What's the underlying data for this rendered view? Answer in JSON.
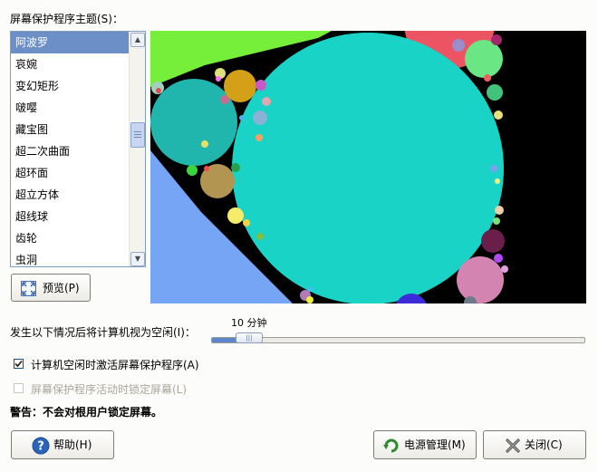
{
  "theme_label": "屏幕保护程序主题(S)：",
  "themes": [
    "阿波罗",
    "哀婉",
    "变幻矩形",
    "啵嘤",
    "藏宝图",
    "超二次曲面",
    "超环面",
    "超立方体",
    "超线球",
    "齿轮",
    "虫洞"
  ],
  "selected_theme": "阿波罗",
  "preview_button": "预览(P)",
  "idle_label": "发生以下情况后将计算机视为空闲(I)：",
  "idle_value": "10 分钟",
  "idle_fraction": 0.09,
  "activate_checkbox": {
    "label": "计算机空闲时激活屏幕保护程序(A)",
    "checked": true
  },
  "lock_checkbox": {
    "label": "屏幕保护程序活动时锁定屏幕(L)",
    "checked": false,
    "disabled": true
  },
  "warning": "警告：不会对根用户锁定屏幕。",
  "help_button": "帮助(H)",
  "power_button": "电源管理(M)",
  "close_button": "关闭(C)",
  "colors": {
    "accent": "#6d8fc8",
    "slider_fill": "#5e86cf",
    "preview_main_circle": "#19d4c6"
  },
  "icons": [
    "scroll-up-icon",
    "scroll-down-icon",
    "fullscreen-icon",
    "help-icon",
    "power-refresh-icon",
    "close-x-icon"
  ]
}
